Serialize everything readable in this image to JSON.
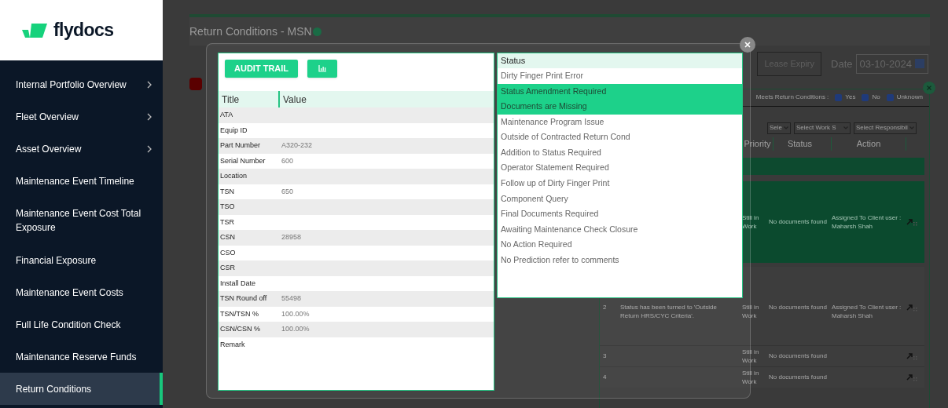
{
  "sidebar": {
    "logo": "flydocs",
    "items": [
      {
        "label": "Internal Portfolio Overview",
        "has_submenu": true,
        "selected": false
      },
      {
        "label": "Fleet Overview",
        "has_submenu": true,
        "selected": false
      },
      {
        "label": "Asset Overview",
        "has_submenu": true,
        "selected": false
      },
      {
        "label": "Maintenance Event Timeline",
        "has_submenu": false,
        "selected": false
      },
      {
        "label": "Maintenance Event Cost Total Exposure",
        "has_submenu": false,
        "selected": false
      },
      {
        "label": "Financial Exposure",
        "has_submenu": false,
        "selected": false
      },
      {
        "label": "Maintenance Event Costs",
        "has_submenu": false,
        "selected": false
      },
      {
        "label": "Full Life Condition Check",
        "has_submenu": false,
        "selected": false
      },
      {
        "label": "Maintenance Reserve Funds",
        "has_submenu": false,
        "selected": false
      },
      {
        "label": "Return Conditions",
        "has_submenu": false,
        "selected": true
      }
    ]
  },
  "page": {
    "title": "Return Conditions - MSN",
    "lease_expiry_button": "Lease Expiry",
    "date_label": "Date",
    "date_value": "03-10-2024",
    "filters": {
      "label": "Meets Return Conditions :",
      "options": [
        {
          "label": "Yes",
          "checked": true
        },
        {
          "label": "No",
          "checked": true
        },
        {
          "label": "Unknown",
          "checked": true
        }
      ]
    },
    "selects": [
      "Sele",
      "Select Work S",
      "Select Responsibil"
    ],
    "columns": [
      "Priority",
      "Status",
      "Action"
    ],
    "rows": [
      {
        "priority": "Still in Work",
        "status": "No documents found",
        "action": "Assigned To Client user : Maharsh Shah",
        "highlighted": true
      },
      {
        "number": "2",
        "description": "Status has been turned to 'Outside Return HRS/CYC Criteria'.",
        "priority": "Still in Work",
        "status": "No documents found",
        "action": "Assigned To Client user : Maharsh Shah",
        "highlighted": false
      },
      {
        "number": "3",
        "priority": "Still in Work",
        "status": "No documents found",
        "highlighted": false
      },
      {
        "number": "4",
        "priority": "Still in Work",
        "status": "No documents found",
        "highlighted": false
      }
    ]
  },
  "modal": {
    "buttons": [
      {
        "kind": "text",
        "label": "AUDIT TRAIL"
      },
      {
        "kind": "chart"
      }
    ],
    "details": {
      "columns": [
        "Title",
        "Value"
      ],
      "rows": [
        {
          "title": "ATA"
        },
        {
          "title": "Equip ID"
        },
        {
          "title": "Part Number",
          "value": "A320-232"
        },
        {
          "title": "Serial Number",
          "value": "600"
        },
        {
          "title": "Location"
        },
        {
          "title": "TSN",
          "value": "650"
        },
        {
          "title": "TSO"
        },
        {
          "title": "TSR"
        },
        {
          "title": "CSN",
          "value": "28958"
        },
        {
          "title": "CSO"
        },
        {
          "title": "CSR"
        },
        {
          "title": "Install Date"
        },
        {
          "title": "TSN Round off",
          "value": "55498"
        },
        {
          "title": "TSN/TSN %",
          "value": "100.00%"
        },
        {
          "title": "CSN/CSN %",
          "value": "100.00%"
        },
        {
          "title": "Remark"
        }
      ]
    },
    "status_list": {
      "header": "Status",
      "items": [
        {
          "label": "Dirty Finger Print Error",
          "selected": false
        },
        {
          "label": "Status Amendment Required",
          "selected": true
        },
        {
          "label": "Documents are Missing",
          "selected": true
        },
        {
          "label": "Maintenance Program Issue",
          "selected": false
        },
        {
          "label": "Outside of Contracted Return Cond",
          "selected": false
        },
        {
          "label": "Addition to Status Required",
          "selected": false
        },
        {
          "label": "Operator Statement Required",
          "selected": false
        },
        {
          "label": "Follow up of Dirty Finger Print",
          "selected": false
        },
        {
          "label": "Component Query",
          "selected": false
        },
        {
          "label": "Final Documents Required",
          "selected": false
        },
        {
          "label": "Awaiting Maintenance Check Closure",
          "selected": false
        },
        {
          "label": "No Action Required",
          "selected": false
        },
        {
          "label": "No Prediction refer to comments",
          "selected": false
        }
      ]
    }
  }
}
